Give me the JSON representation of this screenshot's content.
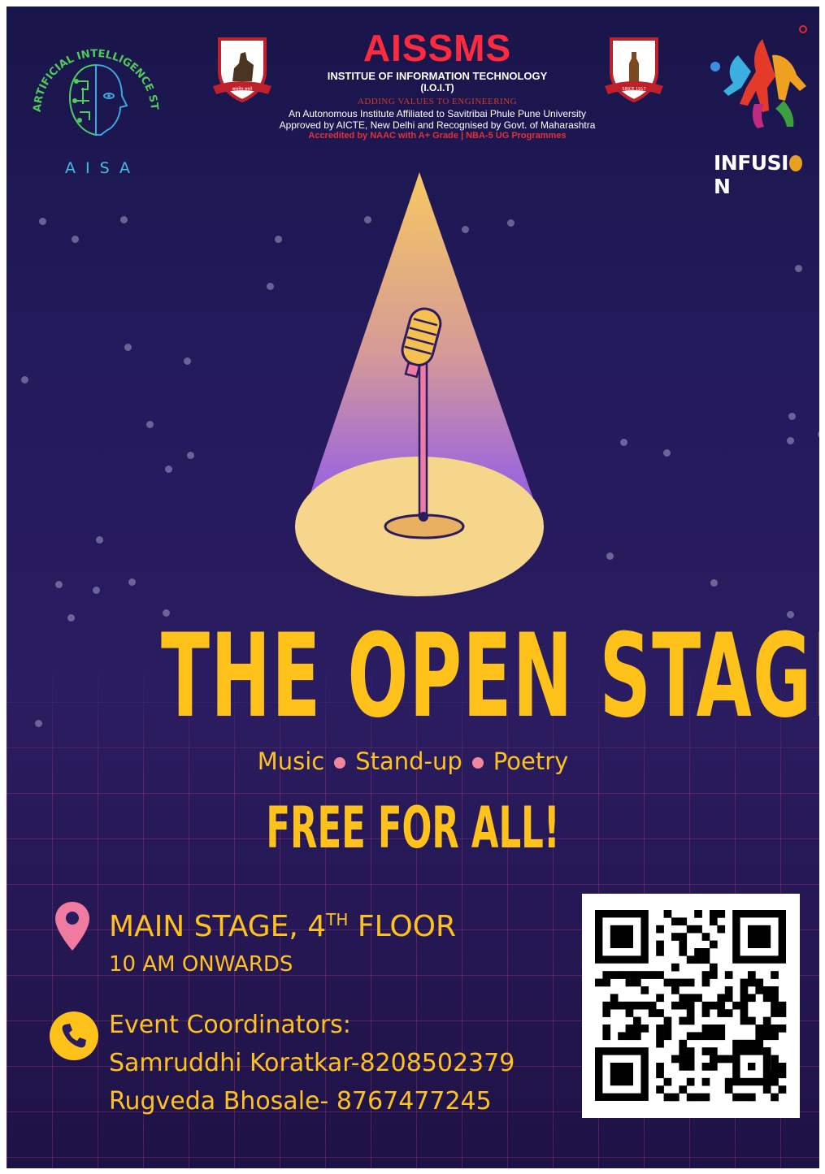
{
  "header": {
    "aisa_ring_text": "ARTIFICIAL INTELLIGENCE STUDENT ASSOCIATION",
    "aisa_label": "AISA",
    "institute_brand": "AISSMS",
    "institute_name": "INSTITUE OF INFORMATION TECHNOLOGY",
    "institute_abbr": "(I.O.I.T)",
    "tagline": "ADDING VALUES TO ENGINEERING",
    "affiliation_line1": "An Autonomous Institute Affiliated to Savitribai Phule Pune University",
    "affiliation_line2": "Approved by AICTE, New Delhi and Recognised by Govt. of Maharashtra",
    "accreditation": "Accredited by NAAC with  A+ Grade | NBA-5 UG Programmes",
    "left_crest_ribbon": "सत्यमेव जयते",
    "right_crest_ribbon": "SINCE 1917",
    "infusion_logo": "INFUSI",
    "infusion_logo_end": "N"
  },
  "event": {
    "title": "THE OPEN STAGE",
    "categories": [
      "Music",
      "Stand-up",
      "Poetry"
    ],
    "free_text": "FREE FOR ALL!",
    "venue": "MAIN STAGE, 4",
    "venue_sup": "TH",
    "venue_end": " FLOOR",
    "time": "10 AM ONWARDS",
    "coordinators_label": "Event Coordinators:",
    "coordinator_1": "Samruddhi Koratkar-8208502379",
    "coordinator_2": "Rugveda Bhosale- 8767477245"
  },
  "icons": {
    "venue": "location-pin-icon",
    "contact": "phone-icon",
    "illustration": "microphone-icon"
  },
  "colors": {
    "accent_yellow": "#ffc21a",
    "pink": "#f0879d",
    "brand_red": "#ff2a3d",
    "background": "#231a5c"
  }
}
